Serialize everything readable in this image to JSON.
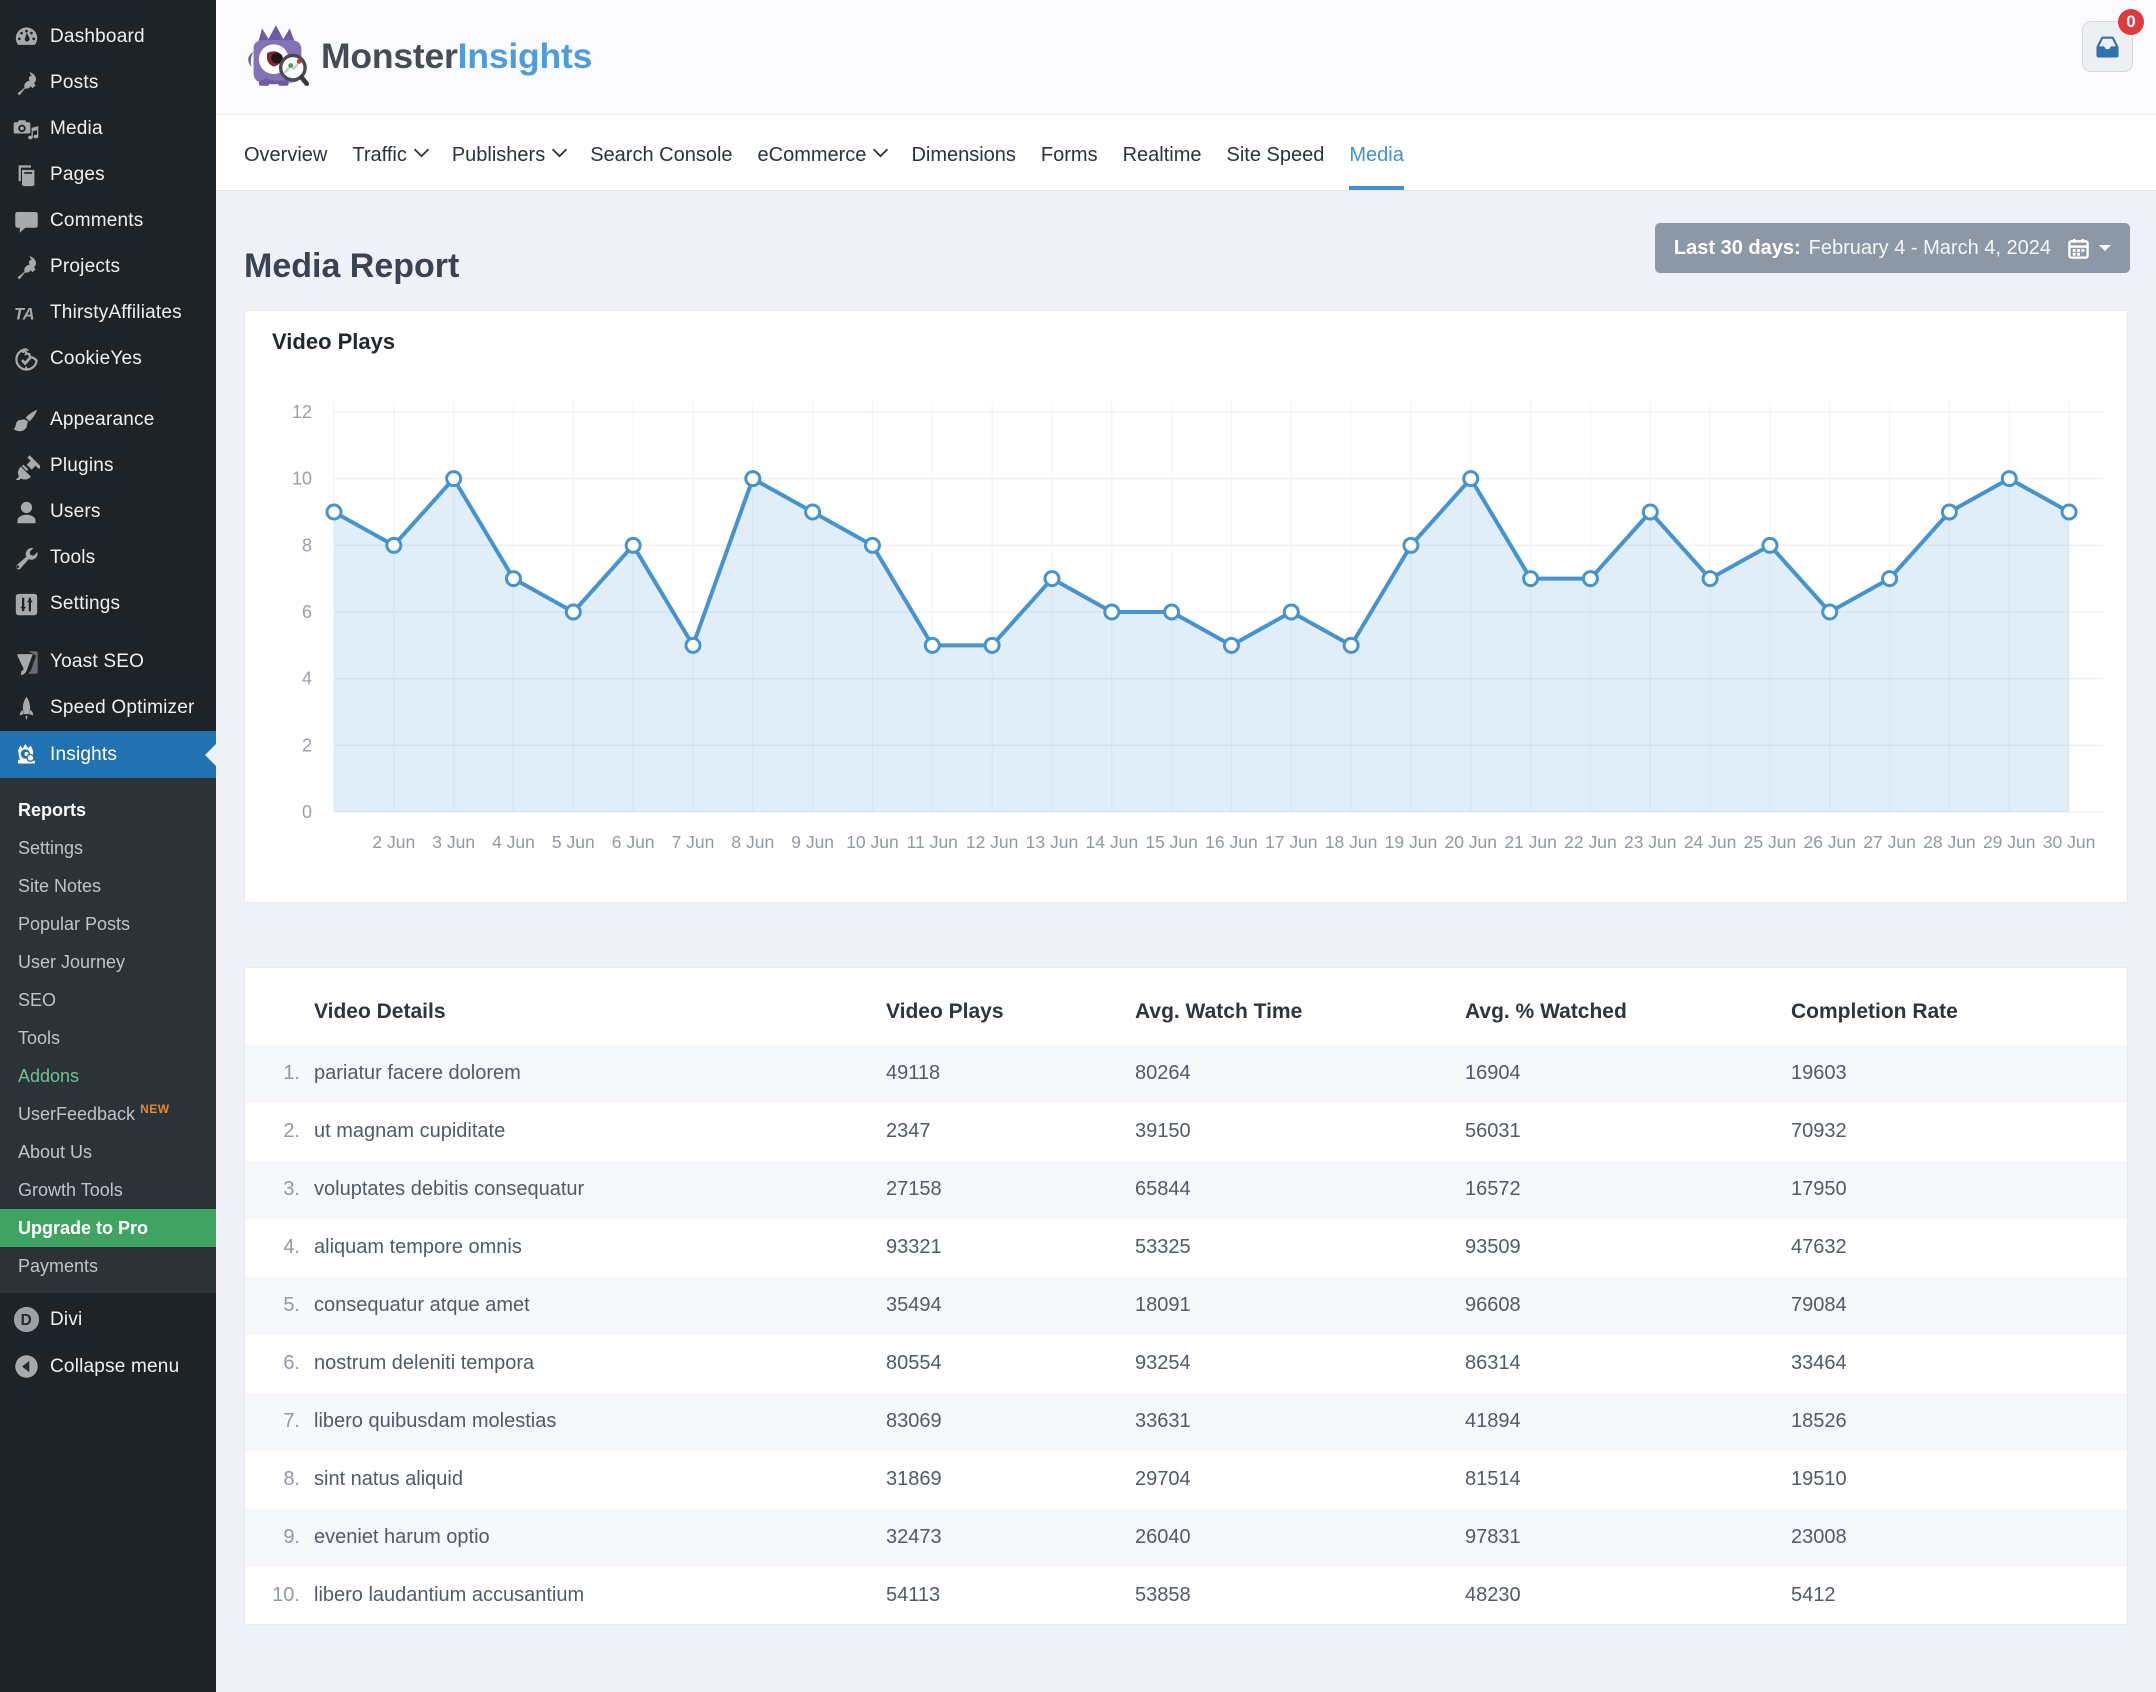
{
  "sidebar": {
    "top_items": [
      {
        "label": "Dashboard",
        "icon": "dashboard-icon"
      },
      {
        "label": "Posts",
        "icon": "pushpin-icon"
      },
      {
        "label": "Media",
        "icon": "media-icon"
      },
      {
        "label": "Pages",
        "icon": "pages-icon"
      },
      {
        "label": "Comments",
        "icon": "comment-icon"
      },
      {
        "label": "Projects",
        "icon": "pushpin-icon"
      },
      {
        "label": "ThirstyAffiliates",
        "icon": "ta-icon"
      },
      {
        "label": "CookieYes",
        "icon": "cookie-icon"
      },
      {
        "label": "Appearance",
        "icon": "brush-icon",
        "sep_before": true
      },
      {
        "label": "Plugins",
        "icon": "plug-icon"
      },
      {
        "label": "Users",
        "icon": "user-icon"
      },
      {
        "label": "Tools",
        "icon": "wrench-icon"
      },
      {
        "label": "Settings",
        "icon": "sliders-icon"
      },
      {
        "label": "Yoast SEO",
        "icon": "yoast-icon",
        "sep_before": true
      },
      {
        "label": "Speed Optimizer",
        "icon": "rocket-icon"
      }
    ],
    "insights": {
      "label": "Insights",
      "icon": "monster-icon"
    },
    "submenu": [
      {
        "label": "Reports",
        "state": "current"
      },
      {
        "label": "Settings"
      },
      {
        "label": "Site Notes"
      },
      {
        "label": "Popular Posts"
      },
      {
        "label": "User Journey"
      },
      {
        "label": "SEO"
      },
      {
        "label": "Tools"
      },
      {
        "label": "Addons",
        "state": "green-text"
      },
      {
        "label": "UserFeedback",
        "badge": "NEW"
      },
      {
        "label": "About Us"
      },
      {
        "label": "Growth Tools"
      },
      {
        "label": "Upgrade to Pro",
        "state": "green-bg"
      },
      {
        "label": "Payments"
      }
    ],
    "bottom_items": [
      {
        "label": "Divi",
        "icon": "divi-icon"
      },
      {
        "label": "Collapse menu",
        "icon": "collapse-icon"
      }
    ]
  },
  "header": {
    "logo_part1": "Monster",
    "logo_part2": "Insights",
    "inbox_badge": "0"
  },
  "tabs": [
    {
      "label": "Overview"
    },
    {
      "label": "Traffic",
      "dropdown": true
    },
    {
      "label": "Publishers",
      "dropdown": true
    },
    {
      "label": "Search Console"
    },
    {
      "label": "eCommerce",
      "dropdown": true
    },
    {
      "label": "Dimensions"
    },
    {
      "label": "Forms"
    },
    {
      "label": "Realtime"
    },
    {
      "label": "Site Speed"
    },
    {
      "label": "Media",
      "active": true
    }
  ],
  "page": {
    "title": "Media Report",
    "date_label_bold": "Last 30 days:",
    "date_range": "February 4 - March 4, 2024"
  },
  "chart_data": {
    "type": "line",
    "title": "Video Plays",
    "x": [
      1,
      2,
      3,
      4,
      5,
      6,
      7,
      8,
      9,
      10,
      11,
      12,
      13,
      14,
      15,
      16,
      17,
      18,
      19,
      20,
      21,
      22,
      23,
      24,
      25,
      26,
      27,
      28,
      29,
      30
    ],
    "x_labels": [
      "",
      "2 Jun",
      "3 Jun",
      "4 Jun",
      "5 Jun",
      "6 Jun",
      "7 Jun",
      "8 Jun",
      "9 Jun",
      "10 Jun",
      "11 Jun",
      "12 Jun",
      "13 Jun",
      "14 Jun",
      "15 Jun",
      "16 Jun",
      "17 Jun",
      "18 Jun",
      "19 Jun",
      "20 Jun",
      "21 Jun",
      "22 Jun",
      "23 Jun",
      "24 Jun",
      "25 Jun",
      "26 Jun",
      "27 Jun",
      "28 Jun",
      "29 Jun",
      "30 Jun"
    ],
    "values": [
      9,
      8,
      10,
      7,
      6,
      8,
      5,
      10,
      9,
      8,
      5,
      5,
      7,
      6,
      6,
      5,
      6,
      5,
      8,
      10,
      7,
      7,
      9,
      7,
      8,
      6,
      7,
      9,
      10,
      9
    ],
    "ylim": [
      0,
      12
    ],
    "yticks": [
      0,
      2,
      4,
      6,
      8,
      10,
      12
    ],
    "line_color": "#4593d1",
    "fill_color": "rgba(69,147,209,0.16)",
    "point_fill": "#ffffff",
    "grid": true,
    "legend": false
  },
  "table": {
    "headers": [
      "Video Details",
      "Video Plays",
      "Avg. Watch Time",
      "Avg. % Watched",
      "Completion Rate"
    ],
    "rows": [
      {
        "rank": "1.",
        "name": "pariatur facere dolorem",
        "plays": "49118",
        "watch_time": "80264",
        "pct_watched": "16904",
        "completion": "19603"
      },
      {
        "rank": "2.",
        "name": "ut magnam cupiditate",
        "plays": "2347",
        "watch_time": "39150",
        "pct_watched": "56031",
        "completion": "70932"
      },
      {
        "rank": "3.",
        "name": "voluptates debitis consequatur",
        "plays": "27158",
        "watch_time": "65844",
        "pct_watched": "16572",
        "completion": "17950"
      },
      {
        "rank": "4.",
        "name": "aliquam tempore omnis",
        "plays": "93321",
        "watch_time": "53325",
        "pct_watched": "93509",
        "completion": "47632"
      },
      {
        "rank": "5.",
        "name": "consequatur atque amet",
        "plays": "35494",
        "watch_time": "18091",
        "pct_watched": "96608",
        "completion": "79084"
      },
      {
        "rank": "6.",
        "name": "nostrum deleniti tempora",
        "plays": "80554",
        "watch_time": "93254",
        "pct_watched": "86314",
        "completion": "33464"
      },
      {
        "rank": "7.",
        "name": "libero quibusdam molestias",
        "plays": "83069",
        "watch_time": "33631",
        "pct_watched": "41894",
        "completion": "18526"
      },
      {
        "rank": "8.",
        "name": "sint natus aliquid",
        "plays": "31869",
        "watch_time": "29704",
        "pct_watched": "81514",
        "completion": "19510"
      },
      {
        "rank": "9.",
        "name": "eveniet harum optio",
        "plays": "32473",
        "watch_time": "26040",
        "pct_watched": "97831",
        "completion": "23008"
      },
      {
        "rank": "10.",
        "name": "libero laudantium accusantium",
        "plays": "54113",
        "watch_time": "53858",
        "pct_watched": "48230",
        "completion": "5412"
      }
    ]
  },
  "colors": {
    "sidebar_bg": "#1d2327",
    "submenu_bg": "#2c3338",
    "active_blue": "#2271b1",
    "upgrade_green": "#41a362",
    "addons_green": "#72c092",
    "new_badge_orange": "#e8862f",
    "content_bg": "#f0f1f7",
    "accent_blue": "#4191d6",
    "date_btn_bg": "#8d98a7",
    "badge_red": "#dd3c3c"
  }
}
